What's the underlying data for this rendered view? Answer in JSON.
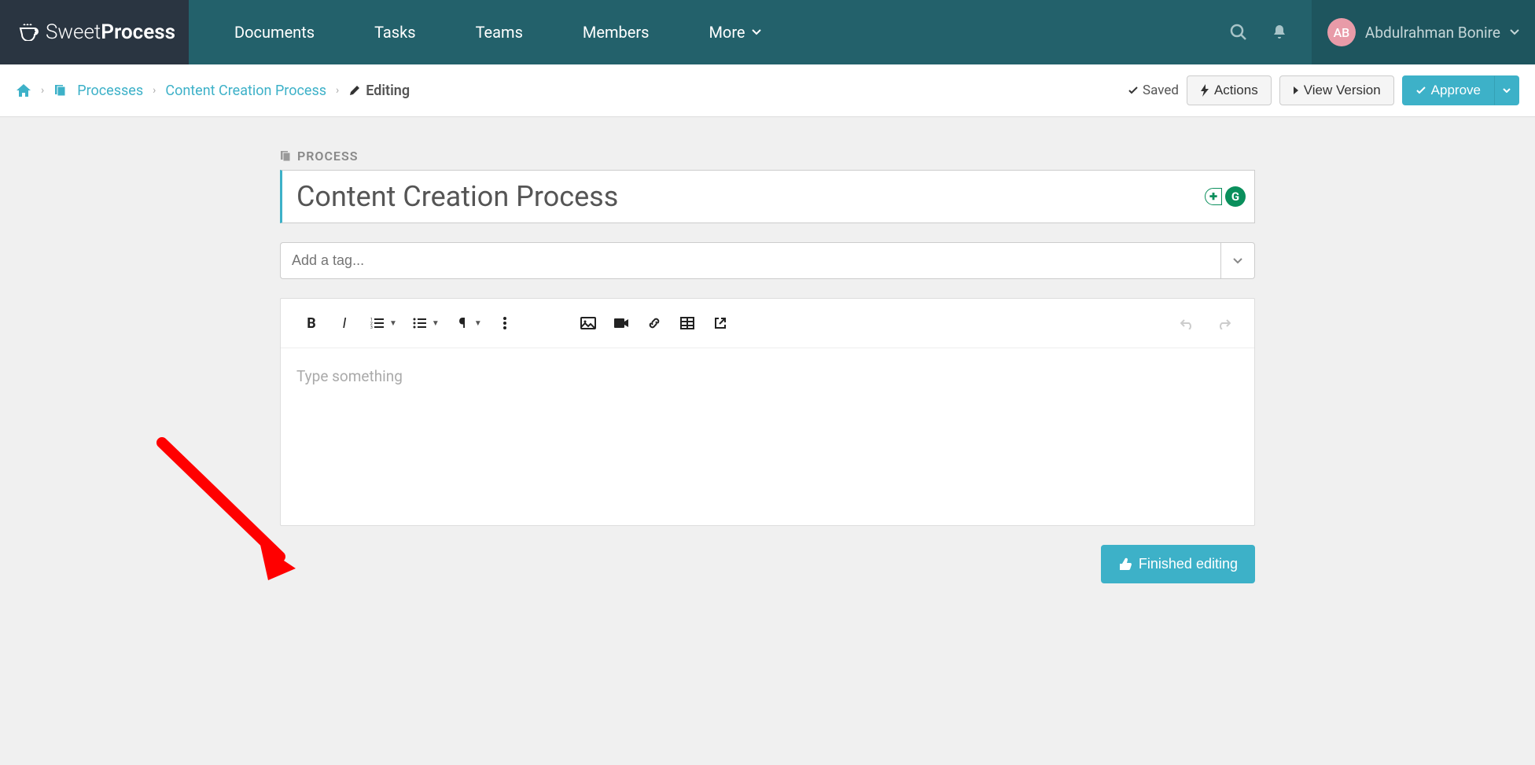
{
  "brand": {
    "thin": "Sweet",
    "bold": "Process"
  },
  "nav": {
    "items": [
      "Documents",
      "Tasks",
      "Teams",
      "Members",
      "More"
    ]
  },
  "user": {
    "initials": "AB",
    "name": "Abdulrahman Bonire"
  },
  "breadcrumb": {
    "home_icon": "home",
    "items": [
      {
        "label": "Processes",
        "icon": "stack"
      },
      {
        "label": "Content Creation Process"
      }
    ],
    "current": "Editing"
  },
  "toolbar": {
    "saved": "Saved",
    "actions": "Actions",
    "view_version": "View Version",
    "approve": "Approve"
  },
  "process": {
    "label": "PROCESS",
    "title": "Content Creation Process"
  },
  "tags": {
    "placeholder": "Add a tag..."
  },
  "editor": {
    "placeholder": "Type something"
  },
  "finished": "Finished editing"
}
